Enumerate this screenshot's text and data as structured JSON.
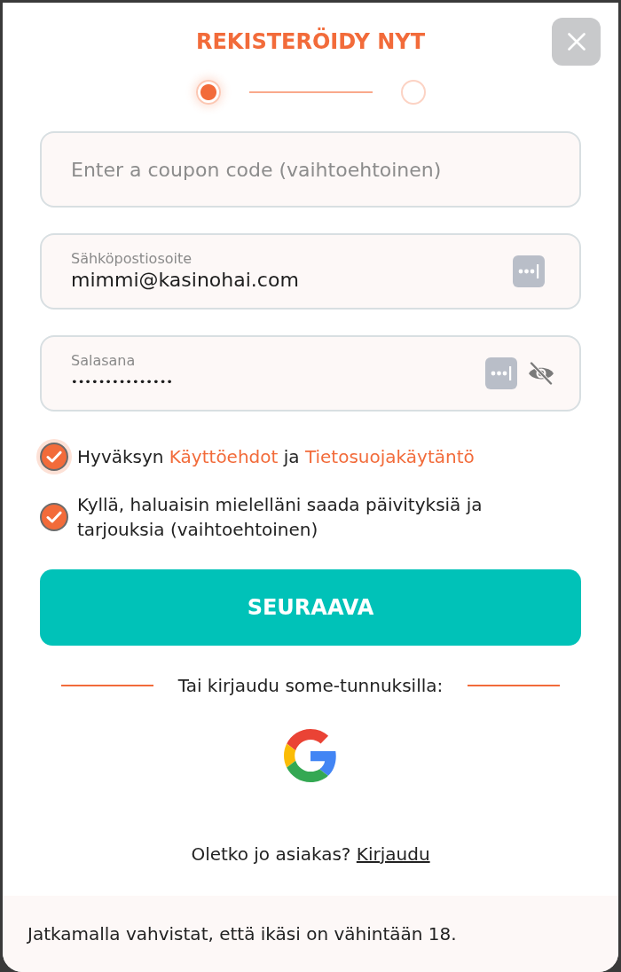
{
  "dialog": {
    "title": "REKISTERÖIDY NYT"
  },
  "steps": [
    {
      "selected": true
    },
    {
      "selected": false
    }
  ],
  "fields": [
    {
      "kind": "text",
      "placeholder": "Enter a coupon code (vaihtoehtoinen)"
    },
    {
      "kind": "email",
      "label": "Sähköpostiosoite",
      "value": "mimmi@kasinohai.com"
    },
    {
      "kind": "password",
      "label": "Salasana",
      "value": "•••••••••••••••",
      "revealed": false
    }
  ],
  "checkboxes": [
    {
      "checked": true,
      "focused": true,
      "parts": [
        {
          "kind": "text",
          "text": "Hyväksyn"
        },
        {
          "kind": "link",
          "text": "Käyttöehdot"
        },
        {
          "kind": "text",
          "text": "ja"
        },
        {
          "kind": "link",
          "text": "Tietosuojakäytäntö"
        }
      ]
    },
    {
      "checked": true,
      "focused": false,
      "parts": [
        {
          "kind": "text",
          "text": "Kyllä, haluaisin mielelläni saada päivityksiä ja tarjouksia (vaihtoehtoinen)"
        }
      ]
    }
  ],
  "next_button": {
    "label": "SEURAAVA"
  },
  "social_login": {
    "title": "Tai kirjaudu some-tunnuksilla:",
    "providers": [
      {
        "kind": "google"
      }
    ]
  },
  "login_prompt": {
    "text": "Oletko jo asiakas?",
    "link": "Kirjaudu"
  },
  "footer": {
    "text": "Jatkamalla vahvistat, että ikäsi on vähintään 18."
  }
}
